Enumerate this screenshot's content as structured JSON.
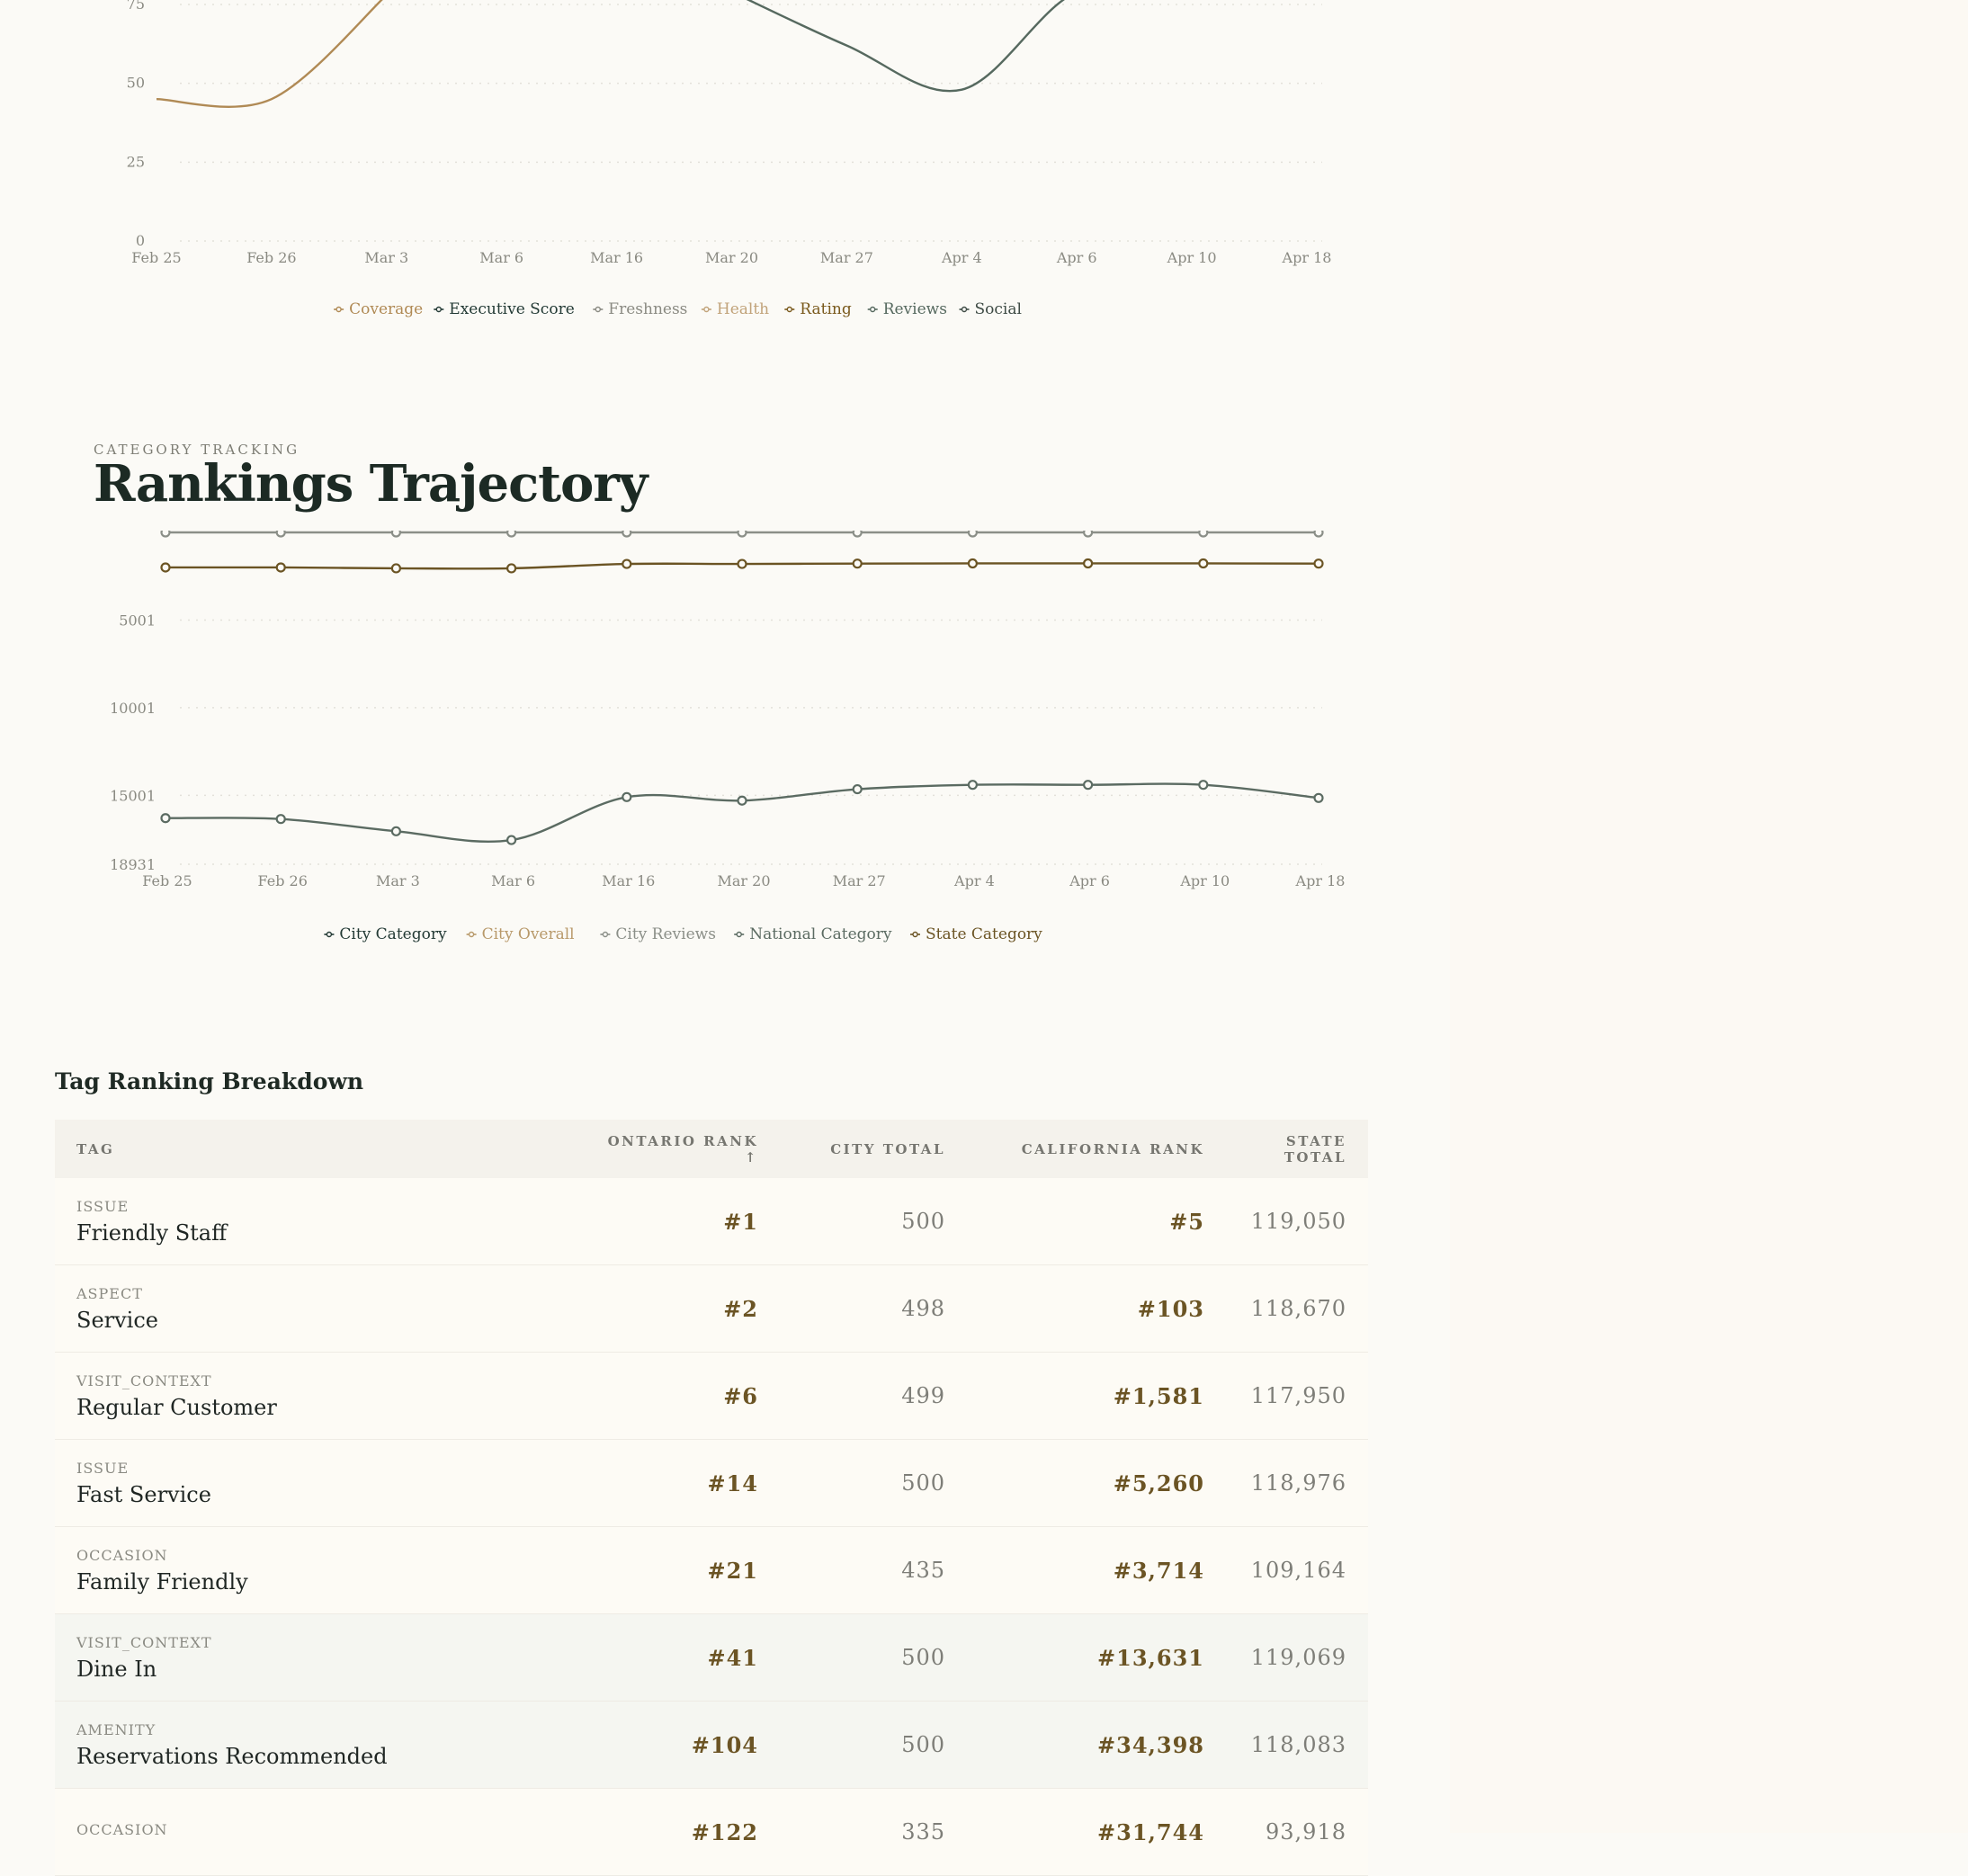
{
  "chart_data": [
    {
      "type": "line",
      "x": [
        "Feb 25",
        "Feb 26",
        "Mar 3",
        "Mar 6",
        "Mar 16",
        "Mar 20",
        "Mar 27",
        "Apr 4",
        "Apr 6",
        "Apr 10",
        "Apr 18"
      ],
      "yticks": [
        "0",
        "25",
        "50",
        "75"
      ],
      "ylim": [
        0,
        75
      ],
      "series": [
        {
          "name": "Coverage",
          "color": "#b08a55",
          "values": [
            45,
            45,
            78,
            null,
            null,
            null,
            null,
            null,
            null,
            null,
            null
          ]
        },
        {
          "name": "Executive Score",
          "color": "#233a35",
          "values": []
        },
        {
          "name": "Freshness",
          "color": "#8a8a82",
          "values": []
        },
        {
          "name": "Health",
          "color": "#c1a37a",
          "values": []
        },
        {
          "name": "Rating",
          "color": "#7a5a1d",
          "values": []
        },
        {
          "name": "Reviews",
          "color": "#56695f",
          "values": [
            null,
            null,
            null,
            null,
            null,
            79,
            62,
            48,
            79,
            79,
            78
          ]
        },
        {
          "name": "Social",
          "color": "#3d4a44",
          "values": []
        }
      ]
    },
    {
      "type": "line",
      "x": [
        "Feb 25",
        "Feb 26",
        "Mar 3",
        "Mar 6",
        "Mar 16",
        "Mar 20",
        "Mar 27",
        "Apr 4",
        "Apr 6",
        "Apr 10",
        "Apr 18"
      ],
      "yticks": [
        "5001",
        "10001",
        "15001",
        "18931"
      ],
      "ylim": [
        18931,
        1
      ],
      "series": [
        {
          "name": "City Category",
          "color": "#233a35",
          "values": []
        },
        {
          "name": "City Overall",
          "color": "#b8996a",
          "values": []
        },
        {
          "name": "City Reviews",
          "color": "#8b8f88",
          "values": [
            1,
            1,
            1,
            1,
            1,
            1,
            1,
            1,
            1,
            1,
            1
          ]
        },
        {
          "name": "National Category",
          "color": "#5b6b62",
          "values": [
            16300,
            16350,
            17050,
            17550,
            15100,
            15300,
            14650,
            14400,
            14400,
            14400,
            15150
          ]
        },
        {
          "name": "State Category",
          "color": "#6b5424",
          "values": [
            2000,
            2000,
            2050,
            2050,
            1800,
            1800,
            1780,
            1770,
            1770,
            1770,
            1780
          ]
        }
      ]
    }
  ],
  "section": {
    "eyebrow": "CATEGORY TRACKING",
    "title": "Rankings Trajectory"
  },
  "table": {
    "title": "Tag Ranking Breakdown",
    "headers": {
      "tag": "TAG",
      "ontario_rank": "ONTARIO RANK ↑",
      "city_total": "CITY TOTAL",
      "california_rank": "CALIFORNIA RANK",
      "state_total": "STATE TOTAL"
    },
    "rows": [
      {
        "category": "ISSUE",
        "name": "Friendly Staff",
        "ontario_rank": "#1",
        "city_total": "500",
        "california_rank": "#5",
        "state_total": "119,050"
      },
      {
        "category": "ASPECT",
        "name": "Service",
        "ontario_rank": "#2",
        "city_total": "498",
        "california_rank": "#103",
        "state_total": "118,670"
      },
      {
        "category": "VISIT_CONTEXT",
        "name": "Regular Customer",
        "ontario_rank": "#6",
        "city_total": "499",
        "california_rank": "#1,581",
        "state_total": "117,950"
      },
      {
        "category": "ISSUE",
        "name": "Fast Service",
        "ontario_rank": "#14",
        "city_total": "500",
        "california_rank": "#5,260",
        "state_total": "118,976"
      },
      {
        "category": "OCCASION",
        "name": "Family Friendly",
        "ontario_rank": "#21",
        "city_total": "435",
        "california_rank": "#3,714",
        "state_total": "109,164"
      },
      {
        "category": "VISIT_CONTEXT",
        "name": "Dine In",
        "ontario_rank": "#41",
        "city_total": "500",
        "california_rank": "#13,631",
        "state_total": "119,069"
      },
      {
        "category": "AMENITY",
        "name": "Reservations Recommended",
        "ontario_rank": "#104",
        "city_total": "500",
        "california_rank": "#34,398",
        "state_total": "118,083"
      },
      {
        "category": "OCCASION",
        "name": "",
        "ontario_rank": "#122",
        "city_total": "335",
        "california_rank": "#31,744",
        "state_total": "93,918"
      }
    ]
  }
}
